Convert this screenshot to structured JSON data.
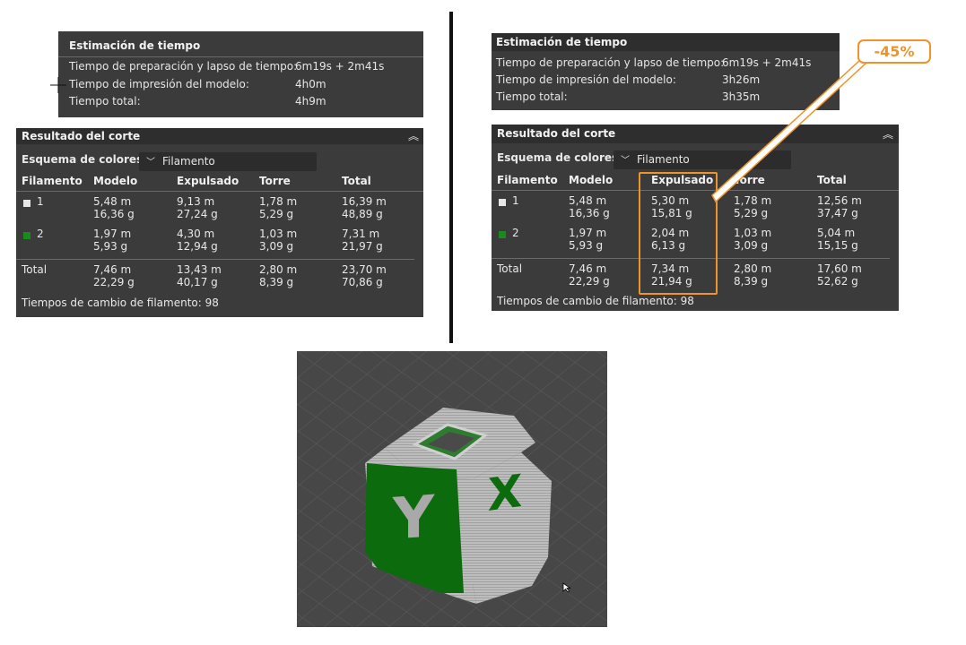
{
  "left": {
    "estimation": {
      "title": "Estimación de tiempo",
      "rows": [
        {
          "label": "Tiempo de preparación y lapso de tiempo:",
          "value": "6m19s + 2m41s"
        },
        {
          "label": "Tiempo de impresión del modelo:",
          "value": "4h0m"
        },
        {
          "label": "Tiempo total:",
          "value": "4h9m"
        }
      ]
    },
    "result": {
      "title": "Resultado del corte",
      "scheme_label": "Esquema de colores",
      "scheme_value": "Filamento",
      "headers": [
        "Filamento",
        "Modelo",
        "Expulsado",
        "Torre",
        "Total"
      ],
      "rows": [
        {
          "id": "1",
          "model": [
            "5,48 m",
            "16,36 g"
          ],
          "flushed": [
            "9,13 m",
            "27,24 g"
          ],
          "tower": [
            "1,78 m",
            "5,29 g"
          ],
          "total": [
            "16,39 m",
            "48,89 g"
          ]
        },
        {
          "id": "2",
          "model": [
            "1,97 m",
            "5,93 g"
          ],
          "flushed": [
            "4,30 m",
            "12,94 g"
          ],
          "tower": [
            "1,03 m",
            "3,09 g"
          ],
          "total": [
            "7,31 m",
            "21,97 g"
          ]
        }
      ],
      "total_row": {
        "label": "Total",
        "model": [
          "7,46 m",
          "22,29 g"
        ],
        "flushed": [
          "13,43 m",
          "40,17 g"
        ],
        "tower": [
          "2,80 m",
          "8,39 g"
        ],
        "total": [
          "23,70 m",
          "70,86 g"
        ]
      },
      "footer_label": "Tiempos de cambio de filamento:",
      "footer_value": "98"
    }
  },
  "right": {
    "estimation": {
      "title": "Estimación de tiempo",
      "rows": [
        {
          "label": "Tiempo de preparación y lapso de tiempo:",
          "value": "6m19s + 2m41s"
        },
        {
          "label": "Tiempo de impresión del modelo:",
          "value": "3h26m"
        },
        {
          "label": "Tiempo total:",
          "value": "3h35m"
        }
      ]
    },
    "result": {
      "title": "Resultado del corte",
      "scheme_label": "Esquema de colores",
      "scheme_value": "Filamento",
      "headers": [
        "Filamento",
        "Modelo",
        "Expulsado",
        "Torre",
        "Total"
      ],
      "rows": [
        {
          "id": "1",
          "model": [
            "5,48 m",
            "16,36 g"
          ],
          "flushed": [
            "5,30 m",
            "15,81 g"
          ],
          "tower": [
            "1,78 m",
            "5,29 g"
          ],
          "total": [
            "12,56 m",
            "37,47 g"
          ]
        },
        {
          "id": "2",
          "model": [
            "1,97 m",
            "5,93 g"
          ],
          "flushed": [
            "2,04 m",
            "6,13 g"
          ],
          "tower": [
            "1,03 m",
            "3,09 g"
          ],
          "total": [
            "5,04 m",
            "15,15 g"
          ]
        }
      ],
      "total_row": {
        "label": "Total",
        "model": [
          "7,46 m",
          "22,29 g"
        ],
        "flushed": [
          "7,34 m",
          "21,94 g"
        ],
        "tower": [
          "2,80 m",
          "8,39 g"
        ],
        "total": [
          "17,60 m",
          "52,62 g"
        ]
      },
      "footer_label": "Tiempos de cambio de filamento:",
      "footer_value": "98"
    }
  },
  "annotation": {
    "badge": "-45%"
  },
  "colors": {
    "panel_bg": "#3b3b3b",
    "filament_1": "#e6e6e6",
    "filament_2": "#1a8a1a",
    "highlight": "#f0932a",
    "model_green": "#0c6b0c",
    "model_grey": "#b5b5b5"
  },
  "model_letters": [
    "Y",
    "X"
  ]
}
